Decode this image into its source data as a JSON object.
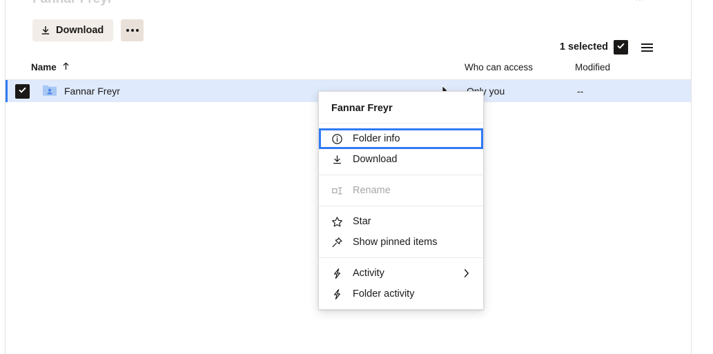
{
  "breadcrumb": {
    "text": "Fannar Freyr",
    "right_text": "..."
  },
  "toolbar": {
    "download_label": "Download",
    "download_icon": "download-icon",
    "more_icon": "ellipsis-icon",
    "selected_label": "1 selected",
    "selected_check_icon": "checkmark-icon",
    "view_icon": "list-view-icon"
  },
  "table": {
    "columns": [
      {
        "key": "name",
        "label": "Name",
        "sort_icon": "arrow-up-icon"
      },
      {
        "key": "access",
        "label": "Who can access"
      },
      {
        "key": "modified",
        "label": "Modified"
      }
    ],
    "rows": [
      {
        "name": "Fannar Freyr",
        "icon": "shared-folder-icon",
        "access": "Only you",
        "modified": "--",
        "selected": true
      }
    ]
  },
  "context_menu": {
    "title": "Fannar Freyr",
    "groups": [
      {
        "items": [
          {
            "label": "Folder info",
            "icon": "info-circle-icon",
            "focused": true,
            "disabled": false,
            "submenu": false
          },
          {
            "label": "Download",
            "icon": "download-icon",
            "focused": false,
            "disabled": false,
            "submenu": false
          }
        ]
      },
      {
        "items": [
          {
            "label": "Rename",
            "icon": "rename-icon",
            "focused": false,
            "disabled": true,
            "submenu": false
          }
        ]
      },
      {
        "items": [
          {
            "label": "Star",
            "icon": "star-icon",
            "focused": false,
            "disabled": false,
            "submenu": false
          },
          {
            "label": "Show pinned items",
            "icon": "pin-icon",
            "focused": false,
            "disabled": false,
            "submenu": false
          }
        ]
      },
      {
        "items": [
          {
            "label": "Activity",
            "icon": "lightning-icon",
            "focused": false,
            "disabled": false,
            "submenu": true
          },
          {
            "label": "Folder activity",
            "icon": "lightning-icon",
            "focused": false,
            "disabled": false,
            "submenu": false
          }
        ]
      }
    ]
  },
  "colors": {
    "accent_blue": "#2f7af5",
    "row_selected_bg": "#dfeafc",
    "button_bg": "#f2ede8",
    "button_alt_bg": "#e9e1d9",
    "text": "#1a1918",
    "disabled_text": "#a9a7a4",
    "folder_icon": "#a8c7f5"
  }
}
